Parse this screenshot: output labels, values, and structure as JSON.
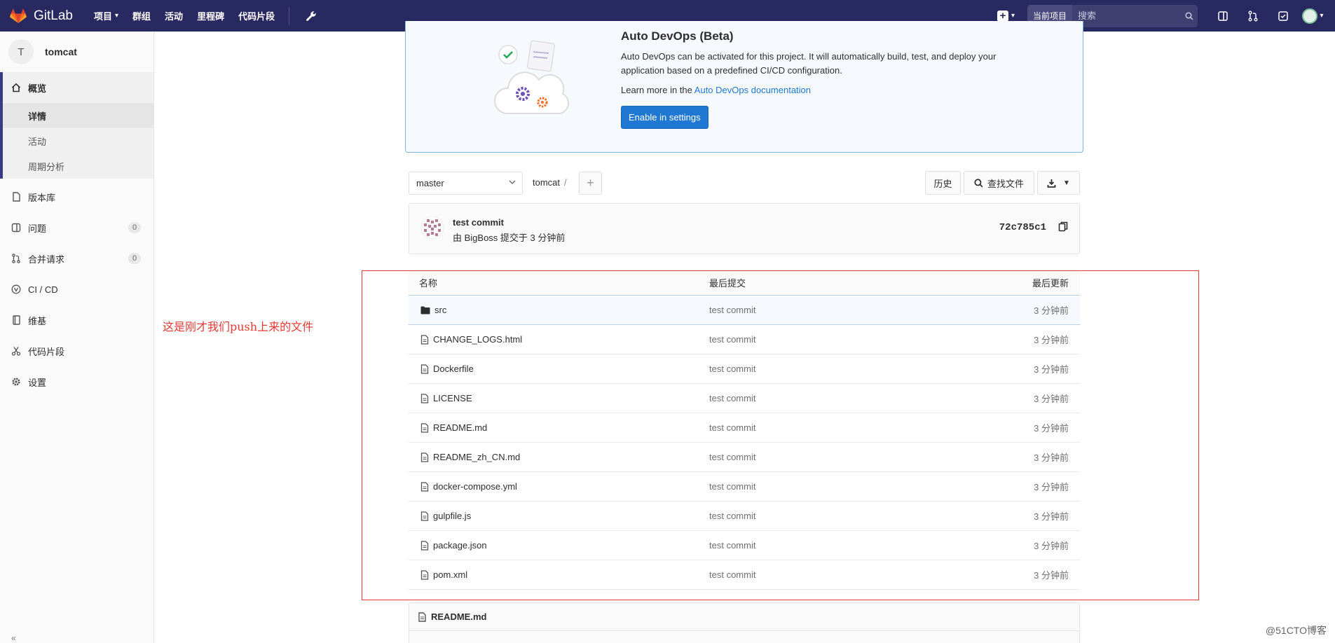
{
  "navbar": {
    "brand": "GitLab",
    "links": [
      {
        "label": "项目",
        "has_caret": true
      },
      {
        "label": "群组",
        "has_caret": false
      },
      {
        "label": "活动",
        "has_caret": false
      },
      {
        "label": "里程碑",
        "has_caret": false
      },
      {
        "label": "代码片段",
        "has_caret": false
      }
    ],
    "search_scope": "当前项目",
    "search_placeholder": "搜索"
  },
  "sidebar": {
    "project_initial": "T",
    "project_name": "tomcat",
    "overview_label": "概览",
    "overview_sub": [
      "详情",
      "活动",
      "周期分析"
    ],
    "items": [
      {
        "label": "版本库",
        "icon": "doc-icon"
      },
      {
        "label": "问题",
        "icon": "issues-icon",
        "badge": "0"
      },
      {
        "label": "合并请求",
        "icon": "merge-request-icon",
        "badge": "0"
      },
      {
        "label": "CI / CD",
        "icon": "ci-cd-icon"
      },
      {
        "label": "维基",
        "icon": "book-icon"
      },
      {
        "label": "代码片段",
        "icon": "scissors-icon"
      },
      {
        "label": "设置",
        "icon": "gear-icon"
      }
    ]
  },
  "banner": {
    "title": "Auto DevOps (Beta)",
    "text": "Auto DevOps can be activated for this project. It will automatically build, test, and deploy your application based on a predefined CI/CD configuration.",
    "learn_prefix": "Learn more in the ",
    "learn_link": "Auto DevOps documentation",
    "button": "Enable in settings"
  },
  "toolbar": {
    "branch": "master",
    "path": "tomcat",
    "history": "历史",
    "find_file": "查找文件"
  },
  "commit": {
    "title": "test commit",
    "meta": "由 BigBoss 提交于 3 分钟前",
    "sha": "72c785c1"
  },
  "table": {
    "headers": {
      "name": "名称",
      "commit": "最后提交",
      "time": "最后更新"
    },
    "rows": [
      {
        "name": "src",
        "type": "folder",
        "commit": "test commit",
        "time": "3 分钟前"
      },
      {
        "name": "CHANGE_LOGS.html",
        "type": "file",
        "commit": "test commit",
        "time": "3 分钟前"
      },
      {
        "name": "Dockerfile",
        "type": "file",
        "commit": "test commit",
        "time": "3 分钟前"
      },
      {
        "name": "LICENSE",
        "type": "file",
        "commit": "test commit",
        "time": "3 分钟前"
      },
      {
        "name": "README.md",
        "type": "file",
        "commit": "test commit",
        "time": "3 分钟前"
      },
      {
        "name": "README_zh_CN.md",
        "type": "file",
        "commit": "test commit",
        "time": "3 分钟前"
      },
      {
        "name": "docker-compose.yml",
        "type": "file",
        "commit": "test commit",
        "time": "3 分钟前"
      },
      {
        "name": "gulpfile.js",
        "type": "file",
        "commit": "test commit",
        "time": "3 分钟前"
      },
      {
        "name": "package.json",
        "type": "file",
        "commit": "test commit",
        "time": "3 分钟前"
      },
      {
        "name": "pom.xml",
        "type": "file",
        "commit": "test commit",
        "time": "3 分钟前"
      }
    ]
  },
  "annotation": "这是刚才我们push上来的文件",
  "readme_title": "README.md",
  "watermark": "@51CTO博客",
  "colors": {
    "navbar": "#292961",
    "accent": "#1f78d1",
    "annotation": "#e53935"
  }
}
